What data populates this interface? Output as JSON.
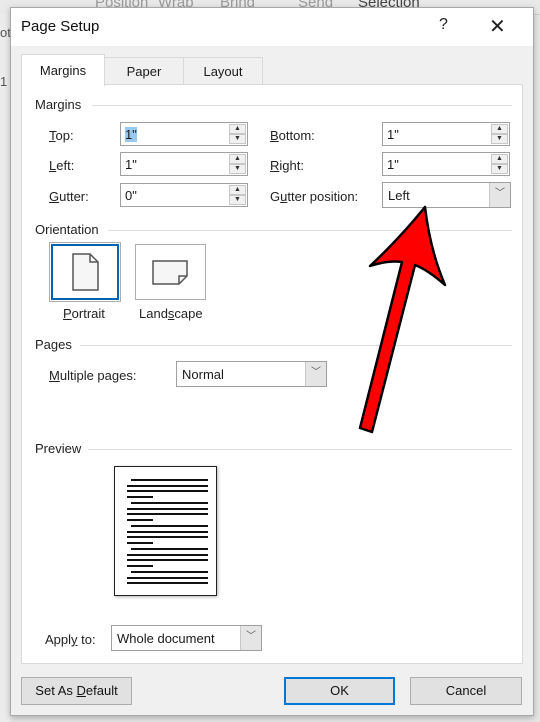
{
  "background": {
    "ribbon_fragments": [
      "Position",
      "Wrap",
      "Bring",
      "Send",
      "Selection"
    ],
    "left_fragments": [
      "ot",
      "1"
    ]
  },
  "dialog": {
    "title": "Page Setup",
    "help_label": "?",
    "close_label": "✕"
  },
  "tabs": [
    {
      "label": "Margins",
      "active": true
    },
    {
      "label": "Paper",
      "active": false
    },
    {
      "label": "Layout",
      "active": false
    }
  ],
  "margins": {
    "group_label": "Margins",
    "top": {
      "label_u": "T",
      "label_rest": "op:",
      "value": "1\""
    },
    "left": {
      "label_u": "L",
      "label_rest": "eft:",
      "value": "1\""
    },
    "gutter": {
      "label_u": "G",
      "label_rest": "utter:",
      "value": "0\""
    },
    "bottom": {
      "label_u": "B",
      "label_rest": "ottom:",
      "value": "1\""
    },
    "right": {
      "label_u": "R",
      "label_rest": "ight:",
      "value": "1\""
    },
    "gutter_position": {
      "label_pre": "G",
      "label_u": "u",
      "label_rest": "tter position:",
      "value": "Left"
    }
  },
  "orientation": {
    "group_label": "Orientation",
    "portrait": {
      "label_u": "P",
      "label_rest": "ortrait",
      "selected": true
    },
    "landscape": {
      "label_pre": "Land",
      "label_u": "s",
      "label_rest": "cape",
      "selected": false
    }
  },
  "pages": {
    "group_label": "Pages",
    "multiple_pages": {
      "label_u": "M",
      "label_rest": "ultiple pages:",
      "value": "Normal"
    }
  },
  "preview": {
    "group_label": "Preview"
  },
  "apply_to": {
    "label_pre": "Appl",
    "label_u": "y",
    "label_rest": " to:",
    "value": "Whole document"
  },
  "buttons": {
    "set_default_pre": "Set As ",
    "set_default_u": "D",
    "set_default_rest": "efault",
    "ok": "OK",
    "cancel": "Cancel"
  },
  "annotation": {
    "arrow_color": "#ff0000",
    "points_to": "gutter-position-combo"
  }
}
